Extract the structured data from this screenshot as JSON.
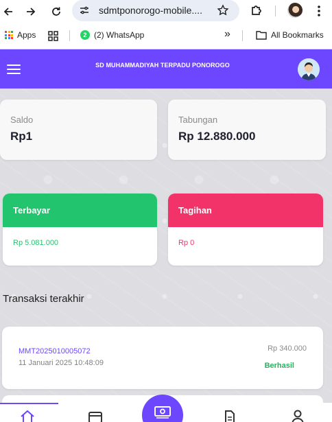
{
  "browser": {
    "url": "sdmtponorogo-mobile....",
    "bookmarks": {
      "apps": "Apps",
      "whatsapp": "(2) WhatsApp",
      "whatsapp_badge": "2",
      "all_bookmarks": "All Bookmarks",
      "overflow": "»"
    }
  },
  "header": {
    "title": "SD MUHAMMADIYAH TERPADU PONOROGO"
  },
  "balances": {
    "saldo": {
      "label": "Saldo",
      "value": "Rp1"
    },
    "tabungan": {
      "label": "Tabungan",
      "value": "Rp 12.880.000"
    }
  },
  "status": {
    "terbayar": {
      "label": "Terbayar",
      "value": "Rp 5.081.000",
      "color": "#22c46e"
    },
    "tagihan": {
      "label": "Tagihan",
      "value": "Rp 0",
      "color": "#f2336a"
    }
  },
  "transactions": {
    "title": "Transaksi terakhir",
    "items": [
      {
        "id": "MMT2025010005072",
        "date": "11 Januari 2025 10:48:09",
        "amount": "Rp 340.000",
        "status": "Berhasil"
      }
    ]
  },
  "colors": {
    "primary": "#6c47ff",
    "success": "#23b55b",
    "danger": "#f2336a"
  },
  "nav": {
    "items": [
      "home-icon",
      "wallet-icon",
      "money-icon",
      "document-icon",
      "user-icon"
    ]
  }
}
